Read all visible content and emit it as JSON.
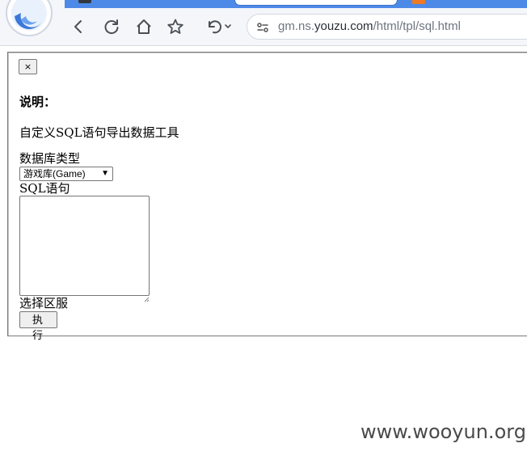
{
  "browser": {
    "url_prefix": "gm.ns.",
    "url_host": "youzu.com",
    "url_path": "/html/tpl/sql.html",
    "icons": [
      "back-icon",
      "reload-icon",
      "home-icon",
      "star-icon",
      "undo-icon",
      "site-info-icon"
    ]
  },
  "page": {
    "close_label": "×",
    "heading": "说明：",
    "description": "自定义SQL语句导出数据工具",
    "db_type_label": "数据库类型",
    "db_type_selected": "游戏库(Game)",
    "sql_label": "SQL语句",
    "sql_value": "",
    "server_label": "选择区服",
    "run_label": "执 行"
  },
  "watermark": "www.wooyun.org",
  "colors": {
    "tab_strip": "#4d8ae8",
    "url_text": "#6e7680",
    "url_host": "#2a2f36"
  }
}
